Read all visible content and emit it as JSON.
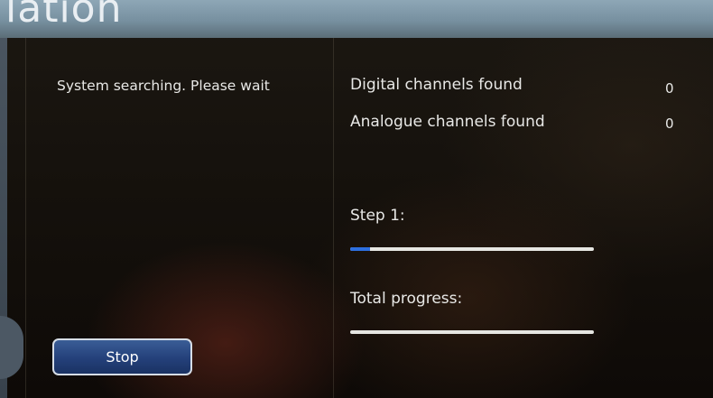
{
  "header": {
    "title": "lation"
  },
  "status": {
    "message": "System searching. Please wait"
  },
  "results": [
    {
      "label": "Digital channels found",
      "count": "0"
    },
    {
      "label": "Analogue channels found",
      "count": "0"
    }
  ],
  "progress": {
    "step": {
      "label": "Step 1:",
      "fraction": 0.08
    },
    "total": {
      "label": "Total progress:",
      "fraction": 0
    }
  },
  "actions": {
    "stop_label": "Stop"
  },
  "colors": {
    "progress_fill": "#2d6fe0",
    "progress_track": "#e6e6e2",
    "button_blue": "#24407a",
    "title_bar": "#7790a0"
  }
}
